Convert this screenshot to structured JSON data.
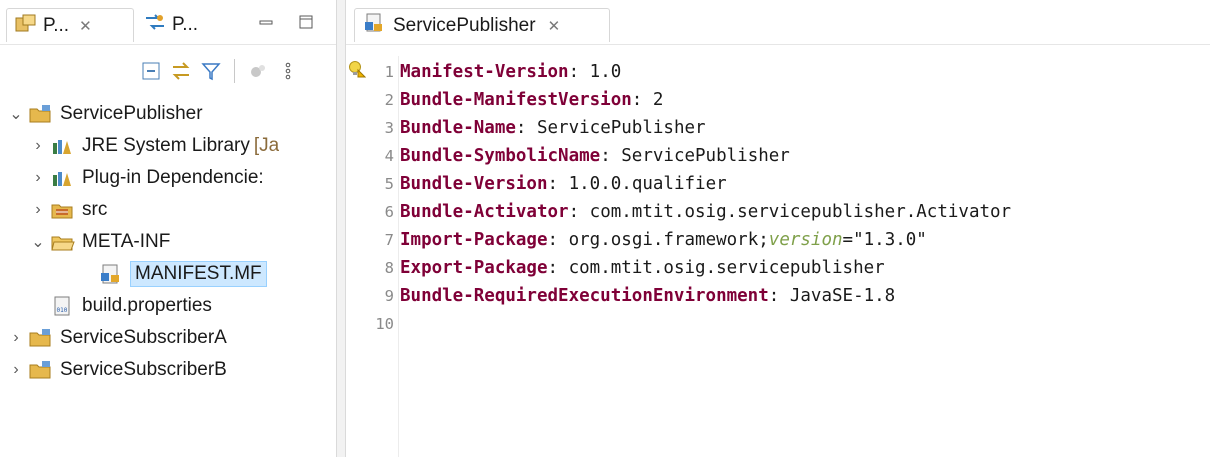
{
  "left_panel": {
    "tabs": [
      {
        "label": "P...",
        "active": true
      },
      {
        "label": "P...",
        "active": false
      }
    ],
    "tree": [
      {
        "label": "ServicePublisher",
        "level": 0,
        "expanded": true,
        "icon": "project-icon"
      },
      {
        "label": "JRE System Library",
        "decoration": "[Ja",
        "level": 1,
        "expanded": false,
        "icon": "library-icon"
      },
      {
        "label": "Plug-in Dependencie:",
        "level": 1,
        "expanded": false,
        "icon": "library-icon"
      },
      {
        "label": "src",
        "level": 1,
        "expanded": false,
        "icon": "source-folder-icon"
      },
      {
        "label": "META-INF",
        "level": 1,
        "expanded": true,
        "icon": "folder-icon"
      },
      {
        "label": "MANIFEST.MF",
        "level": 2,
        "selected": true,
        "icon": "manifest-icon"
      },
      {
        "label": "build.properties",
        "level": 1,
        "icon": "properties-file-icon"
      },
      {
        "label": "ServiceSubscriberA",
        "level": 0,
        "expanded": false,
        "icon": "project-icon"
      },
      {
        "label": "ServiceSubscriberB",
        "level": 0,
        "expanded": false,
        "icon": "project-icon"
      }
    ]
  },
  "editor": {
    "tab_label": "ServicePublisher",
    "lines": [
      {
        "n": "1",
        "key": "Manifest-Version",
        "value": " 1.0"
      },
      {
        "n": "2",
        "key": "Bundle-ManifestVersion",
        "value": " 2"
      },
      {
        "n": "3",
        "key": "Bundle-Name",
        "value": " ServicePublisher"
      },
      {
        "n": "4",
        "key": "Bundle-SymbolicName",
        "value": " ServicePublisher"
      },
      {
        "n": "5",
        "key": "Bundle-Version",
        "value": " 1.0.0.qualifier"
      },
      {
        "n": "6",
        "key": "Bundle-Activator",
        "value": " com.mtit.osig.servicepublisher.Activator"
      },
      {
        "n": "7",
        "key": "Import-Package",
        "value": " org.osgi.framework;",
        "attr": "version",
        "str": "=\"1.3.0\""
      },
      {
        "n": "8",
        "key": "Export-Package",
        "value": " com.mtit.osig.servicepublisher"
      },
      {
        "n": "9",
        "key": "Bundle-RequiredExecutionEnvironment",
        "value": " JavaSE-1.8"
      },
      {
        "n": "10",
        "key": "",
        "value": ""
      }
    ]
  },
  "colors": {
    "manifest_key": "#7f0037",
    "attribute": "#7fa04a",
    "selection": "#cde8ff"
  }
}
